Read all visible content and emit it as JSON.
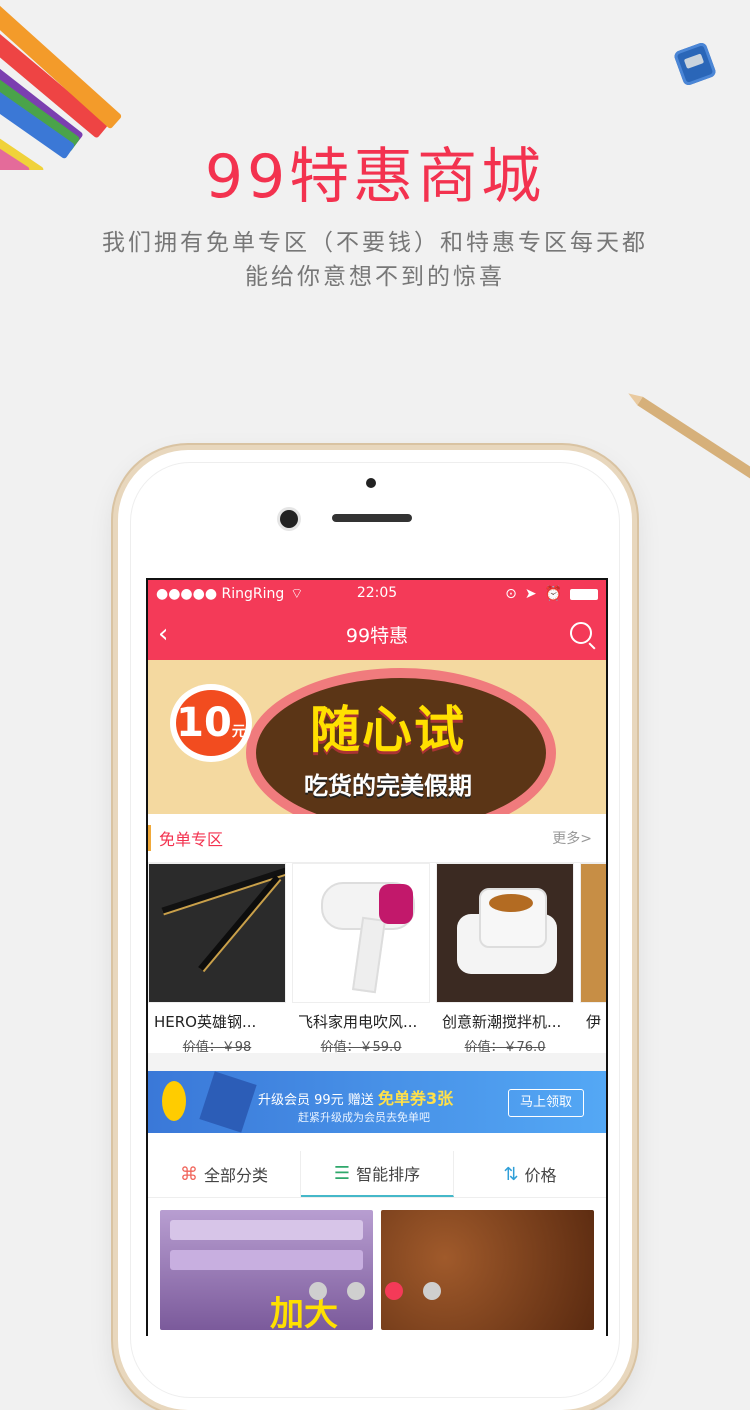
{
  "hero": {
    "title": "99特惠商城",
    "subtitle_line1": "我们拥有免单专区（不要钱）和特惠专区每天都",
    "subtitle_line2": "能给你意想不到的惊喜"
  },
  "status_bar": {
    "carrier": "●●●●● RingRing",
    "time": "22:05"
  },
  "nav": {
    "title": "99特惠",
    "back_icon": "chevron-left-icon",
    "search_icon": "search-icon"
  },
  "banner": {
    "badge_number": "10",
    "badge_unit": "元",
    "headline": "随心试",
    "subline": "吃货的完美假期"
  },
  "free_section": {
    "title": "免单专区",
    "more": "更多>",
    "products": [
      {
        "name": "HERO英雄钢...",
        "price": "价值：￥98"
      },
      {
        "name": "飞科家用电吹风...",
        "price": "价值：￥59.0"
      },
      {
        "name": "创意新潮搅拌机...",
        "price": "价值：￥76.0"
      },
      {
        "name": "伊",
        "price": ""
      }
    ]
  },
  "promo": {
    "text_main_prefix": "升级会员 99元 赠送",
    "text_main_highlight": "免单券3张",
    "text_sub": "赶紧升级成为会员去免单吧",
    "button": "马上领取"
  },
  "filters": [
    {
      "label": "全部分类",
      "icon": "grid-icon"
    },
    {
      "label": "智能排序",
      "icon": "list-icon"
    },
    {
      "label": "价格",
      "icon": "sort-icon"
    }
  ],
  "grid_items": [
    {
      "overlay": "加大"
    },
    {
      "overlay": ""
    }
  ],
  "pagination": {
    "pages": 4,
    "active_index": 2
  }
}
